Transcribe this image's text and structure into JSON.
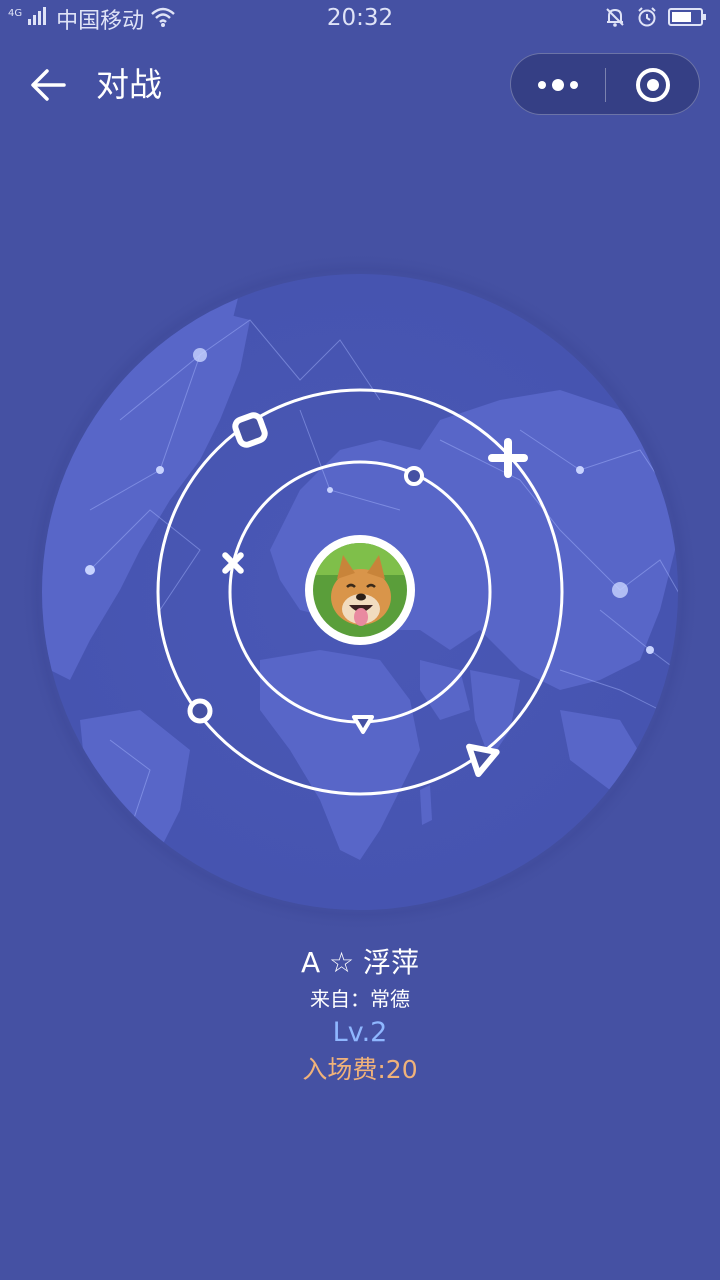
{
  "status_bar": {
    "network_type": "4G",
    "carrier": "中国移动",
    "time": "20:32"
  },
  "nav": {
    "title": "对战"
  },
  "player": {
    "name": "A ☆ 浮萍",
    "origin_label": "来自：",
    "origin_value": "常德",
    "level": "Lv.2",
    "entry_fee": "入场费:20"
  },
  "colors": {
    "background": "#4551a3",
    "globe": "#5866c8",
    "level": "#8fb7ff",
    "entry_fee": "#f0b27a"
  },
  "icons": {
    "back": "arrow-left-icon",
    "more": "more-dots-icon",
    "close": "target-circle-icon",
    "orbit_shapes": [
      "square",
      "plus",
      "cross",
      "small-circle",
      "circle",
      "triangle"
    ]
  }
}
